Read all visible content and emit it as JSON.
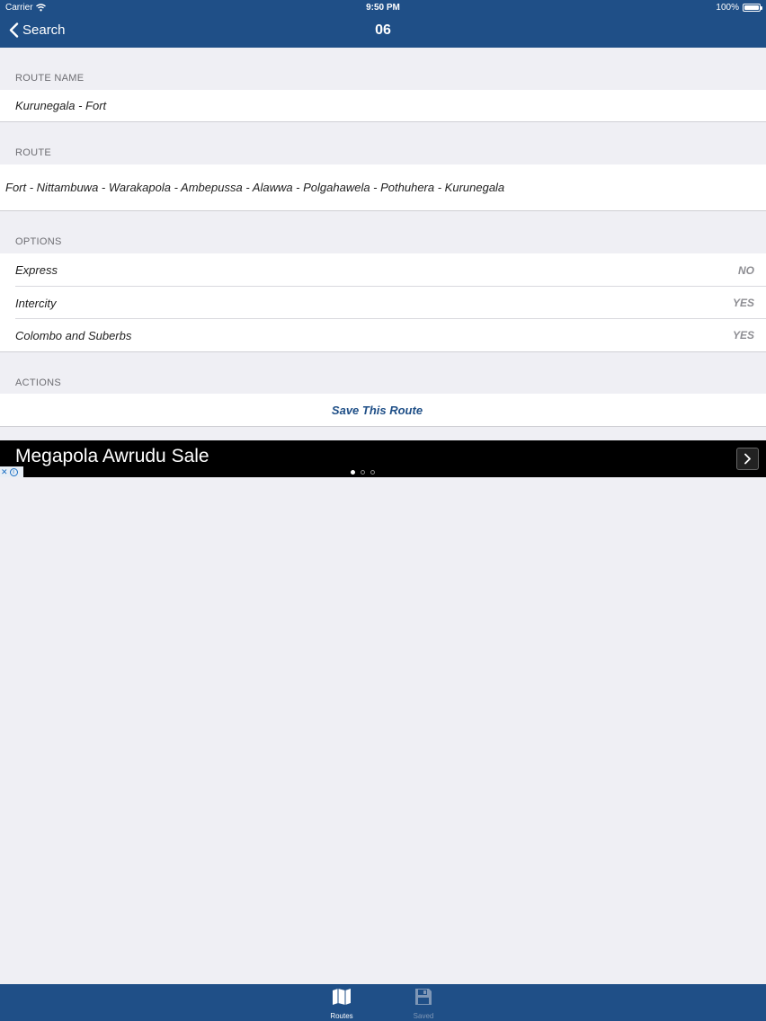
{
  "status_bar": {
    "carrier": "Carrier",
    "time": "9:50 PM",
    "battery": "100%"
  },
  "nav": {
    "back_label": "Search",
    "title": "06"
  },
  "route_name": {
    "header": "ROUTE NAME",
    "value": "Kurunegala - Fort"
  },
  "route": {
    "header": "ROUTE",
    "value": "Fort - Nittambuwa - Warakapola - Ambepussa - Alawwa - Polgahawela - Pothuhera - Kurunegala"
  },
  "options": {
    "header": "OPTIONS",
    "items": [
      {
        "label": "Express",
        "value": "NO"
      },
      {
        "label": "Intercity",
        "value": "YES"
      },
      {
        "label": "Colombo and Suberbs",
        "value": "YES"
      }
    ]
  },
  "actions": {
    "header": "ACTIONS",
    "save_label": "Save This Route"
  },
  "ad": {
    "text": "Megapola Awrudu Sale",
    "next_icon": "chevron-right-icon",
    "choices_icon": "adchoices-icon"
  },
  "tabbar": {
    "items": [
      {
        "label": "Routes",
        "icon": "map-icon",
        "active": true
      },
      {
        "label": "Saved",
        "icon": "floppy-disk-icon",
        "active": false
      }
    ]
  },
  "colors": {
    "brand": "#1f4f87",
    "background": "#efeff4",
    "inactive_tab": "#7f97b6"
  }
}
